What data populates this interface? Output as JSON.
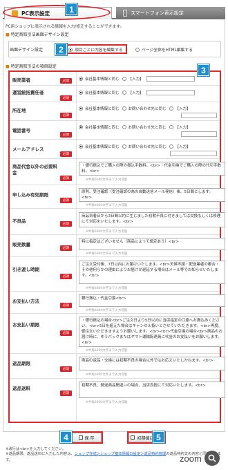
{
  "tabs": {
    "pc": "PC表示設定",
    "smartphone": "スマートフォン表示設定"
  },
  "badges": [
    "1",
    "2",
    "3",
    "4",
    "5"
  ],
  "intro": "PC用ショップに表示される情報を入力/修正することができます。",
  "design_section": {
    "title": "特定商取引法画面デザイン設定",
    "label": "画面デザイン設定",
    "option1": "項目ごとに内容を編集する",
    "option2": "ページ全体をHTML編集する"
  },
  "items_section": {
    "title": "特定商取引法の項目設定",
    "required_label": "必須"
  },
  "radio_rows": [
    {
      "label": "販売業者",
      "options": [
        "会社基本情報と同じ",
        "【入力】"
      ]
    },
    {
      "label": "運営統括責任者",
      "options": [
        "会社基本情報と同じ",
        "【入力】"
      ]
    },
    {
      "label": "所在地",
      "options": [
        "会社基本情報と同じ",
        "お問い合わせ先と同じ",
        "【入力】"
      ]
    },
    {
      "label": "電話番号",
      "options": [
        "会社基本情報と同じ",
        "お問い合わせ先と同じ",
        "【入力】"
      ]
    },
    {
      "label": "メールアドレス",
      "options": [
        "会社基本情報と同じ",
        "お問い合わせ先と同じ",
        "【入力】"
      ]
    }
  ],
  "text_rows": [
    {
      "label": "商品代金以外の必要料金",
      "text": "・銀行振込でご購入の際の振込手数料。<br>・代金引換でご購入の際の代引手数料。<br>"
    },
    {
      "label": "申し込み有効期限",
      "text": "原則、受注確認（受注確認の為の自動送信メール発信）後、5日間とします。<br>"
    },
    {
      "label": "不良品",
      "text": "商品到着日から3日間以内に生じました初期不良に付きましては交換もしくは修理にて対応をいたします。<br>"
    },
    {
      "label": "販売数量",
      "text": "特に指定はございません（商品によって設定あり）<br>"
    },
    {
      "label": "引き渡し時期",
      "text": "ご注文受付後、7日以内にお届けいたします。<br>天候不順・配送業者の都合・その他何らかの理由によりお届けが遅延する場合はメール等でお知らせいたします。<br>"
    },
    {
      "label": "お支払い方法",
      "text": "銀行振込・代金引換<br>"
    },
    {
      "label": "お支払い期限",
      "text": "・銀行振込の場合<br>ご注文日より5日以内に当店指定の口座へお振込みください。<br>5日を超えた場合はキャンセル扱いとさせていただきます。<br>再度、御注文いただきますようお願いします。<br><br>代金引換の場合<br>商品のお届け時に、ゆうパックまたはヤマト運輸配達員に代金のお支払いをお願いします。<br>"
    },
    {
      "label": "返品期限",
      "text": "商品の返品・交換には初期不良の場合以外ではお応えいたしかねます。<br>"
    },
    {
      "label": "返品送料",
      "text": "初期不良、発送商品間違いの場合、当店負担にて対応いたします。<br>"
    }
  ],
  "char_limit": "※半角6000文字まで入力可能",
  "buttons": {
    "save": "保 存",
    "reset": "初期値に戻す"
  },
  "notes": {
    "line1": "※改行は<br>を入力してください。",
    "line2a": "※返品期限、返品送料に入力した内容は、",
    "line2_link": "ショップ作成＞ショップ基本情報の設定＞返品特約管理",
    "line2b": "の返品特約文の内容と同期されます。"
  },
  "zoom": "zoom"
}
